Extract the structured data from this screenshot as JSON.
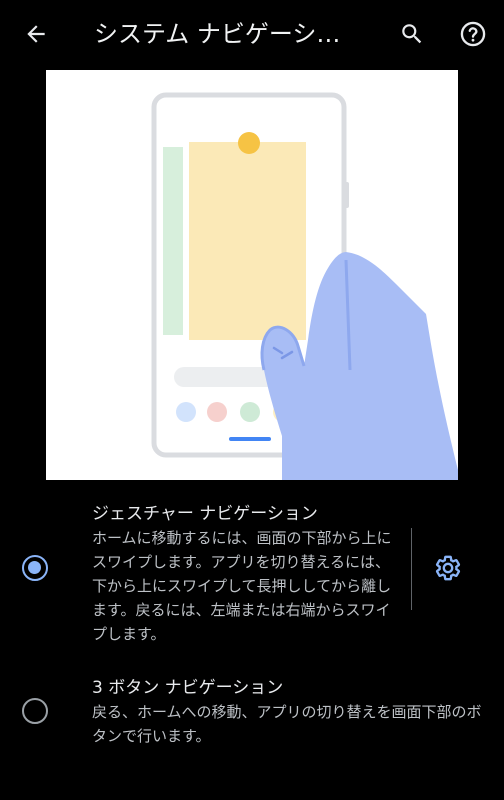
{
  "header": {
    "title": "システム ナビゲーシ…",
    "back_icon": "arrow-back-icon",
    "search_icon": "search-icon",
    "help_icon": "help-icon"
  },
  "illustration": {
    "description_icon": "gesture-navigation-illustration"
  },
  "options": [
    {
      "title": "ジェスチャー ナビゲーション",
      "description": "ホームに移動するには、画面の下部から上にスワイプします。アプリを切り替えるには、下から上にスワイプして長押ししてから離します。戻るには、左端または右端からスワイプします。",
      "selected": true,
      "settings_icon": "gear-icon"
    },
    {
      "title": "3 ボタン ナビゲーション",
      "description": "戻る、ホームへの移動、アプリの切り替えを画面下部のボタンで行います。",
      "selected": false
    }
  ],
  "colors": {
    "accent": "#8ab4f8",
    "background": "#000000",
    "text_primary": "#e8eaed",
    "text_secondary": "#bdc1c6"
  }
}
